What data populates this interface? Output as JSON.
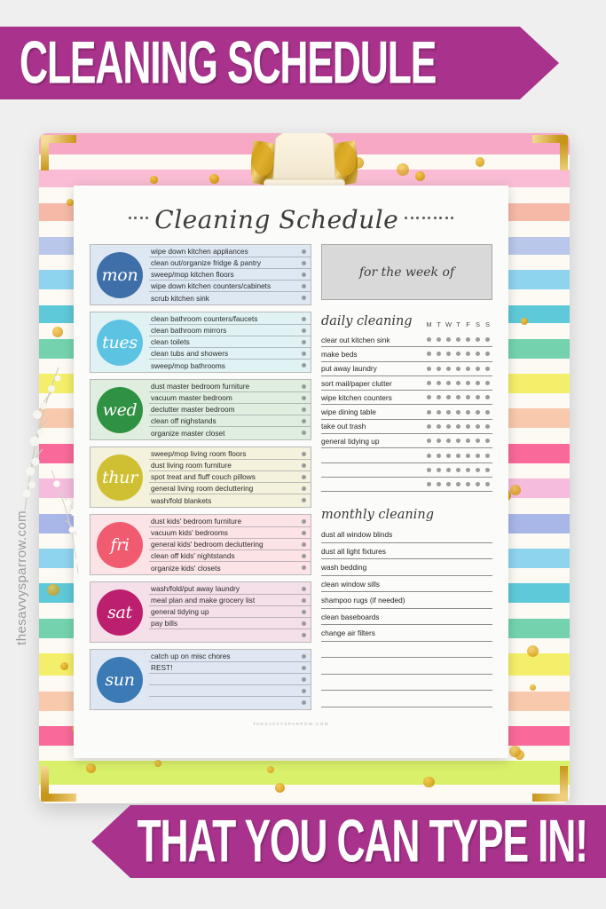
{
  "banners": {
    "top_text": "CLEANING SCHEDULE",
    "bottom_text": "THAT YOU CAN TYPE IN!",
    "color": "#a8328c"
  },
  "side_url": "thesavvysparrow.com",
  "sheet": {
    "title": "Cleaning Schedule",
    "footer": "THESAVVYSPARROW.COM",
    "week_of_label": "for the week of"
  },
  "days": [
    {
      "key": "mon",
      "label": "mon",
      "circle_color": "#3f6fa8",
      "row_color": "#dde8f3",
      "tasks": [
        "wipe down kitchen appliances",
        "clean out/organize fridge & pantry",
        "sweep/mop kitchen floors",
        "wipe down kitchen counters/cabinets",
        "scrub kitchen sink"
      ]
    },
    {
      "key": "tues",
      "label": "tues",
      "circle_color": "#5dc3e3",
      "row_color": "#e0f2f4",
      "tasks": [
        "clean bathroom counters/faucets",
        "clean bathroom mirrors",
        "clean toilets",
        "clean tubs and showers",
        "sweep/mop bathrooms"
      ]
    },
    {
      "key": "wed",
      "label": "wed",
      "circle_color": "#2f9142",
      "row_color": "#dfeede",
      "tasks": [
        "dust master bedroom furniture",
        "vacuum master bedroom",
        "declutter master bedroom",
        "clean off nighstands",
        "organize master closet"
      ]
    },
    {
      "key": "thur",
      "label": "thur",
      "circle_color": "#cfc033",
      "row_color": "#f4f1dc",
      "tasks": [
        "sweep/mop living room floors",
        "dust living room furniture",
        "spot treat and fluff couch pillows",
        "general living room decluttering",
        "wash/fold blankets"
      ]
    },
    {
      "key": "fri",
      "label": "fri",
      "circle_color": "#f15b70",
      "row_color": "#fbe3e6",
      "tasks": [
        "dust kids' bedroom furniture",
        "vacuum kids' bedrooms",
        "general kids' bedroom decluttering",
        "clean off kids' nightstands",
        "organize kids' closets"
      ]
    },
    {
      "key": "sat",
      "label": "sat",
      "circle_color": "#bb1f6e",
      "row_color": "#f5dfe9",
      "tasks": [
        "wash/fold/put away laundry",
        "meal plan and make grocery list",
        "general tidying up",
        "pay bills",
        ""
      ]
    },
    {
      "key": "sun",
      "label": "sun",
      "circle_color": "#3b7ab5",
      "row_color": "#dfe8f2",
      "tasks": [
        "catch up on misc chores",
        "REST!",
        "",
        "",
        ""
      ]
    }
  ],
  "daily": {
    "title": "daily cleaning",
    "dow": [
      "M",
      "T",
      "W",
      "T",
      "F",
      "S",
      "S"
    ],
    "items": [
      "clear out kitchen sink",
      "make beds",
      "put away laundry",
      "sort mail/paper clutter",
      "wipe kitchen counters",
      "wipe dining table",
      "take out trash",
      "general tidying up",
      "",
      "",
      ""
    ]
  },
  "monthly": {
    "title": "monthly cleaning",
    "items": [
      "dust all window blinds",
      "dust all light fixtures",
      "wash bedding",
      "clean window sills",
      "shampoo rugs (if needed)",
      "clean baseboards",
      "change air filters",
      "",
      "",
      "",
      ""
    ]
  },
  "clipboard": {
    "stripes": [
      {
        "color": "#f7a8c4",
        "h": 3.0
      },
      {
        "color": "#fdfaf4",
        "h": 2.2
      },
      {
        "color": "#f9bcd4",
        "h": 2.6
      },
      {
        "color": "#fdfaf4",
        "h": 2.2
      },
      {
        "color": "#f6b9a8",
        "h": 2.6
      },
      {
        "color": "#fdfaf4",
        "h": 2.2
      },
      {
        "color": "#b9c8ea",
        "h": 2.6
      },
      {
        "color": "#fdfaf4",
        "h": 2.2
      },
      {
        "color": "#8fd4ef",
        "h": 2.8
      },
      {
        "color": "#fdfaf4",
        "h": 2.2
      },
      {
        "color": "#5ec9d8",
        "h": 2.6
      },
      {
        "color": "#fdfaf4",
        "h": 2.2
      },
      {
        "color": "#74d3ae",
        "h": 2.8
      },
      {
        "color": "#fdfaf4",
        "h": 2.2
      },
      {
        "color": "#f4ef6a",
        "h": 2.8
      },
      {
        "color": "#fdfaf4",
        "h": 2.2
      },
      {
        "color": "#f8c9ad",
        "h": 2.8
      },
      {
        "color": "#fdfaf4",
        "h": 2.2
      },
      {
        "color": "#f9699a",
        "h": 2.8
      },
      {
        "color": "#fdfaf4",
        "h": 2.2
      },
      {
        "color": "#f5bcdd",
        "h": 2.8
      },
      {
        "color": "#fdfaf4",
        "h": 2.2
      },
      {
        "color": "#a9b6e8",
        "h": 2.8
      },
      {
        "color": "#fdfaf4",
        "h": 2.2
      },
      {
        "color": "#8fd4ef",
        "h": 2.8
      },
      {
        "color": "#fdfaf4",
        "h": 2.2
      },
      {
        "color": "#5ec9d8",
        "h": 2.8
      },
      {
        "color": "#fdfaf4",
        "h": 2.2
      },
      {
        "color": "#74d3ae",
        "h": 2.8
      },
      {
        "color": "#fdfaf4",
        "h": 2.2
      },
      {
        "color": "#f4ef6a",
        "h": 3.2
      },
      {
        "color": "#fdfaf4",
        "h": 2.2
      },
      {
        "color": "#f8c9ad",
        "h": 2.8
      },
      {
        "color": "#fdfaf4",
        "h": 2.2
      },
      {
        "color": "#f9699a",
        "h": 2.8
      },
      {
        "color": "#fdfaf4",
        "h": 2.2
      },
      {
        "color": "#d9f06a",
        "h": 3.4
      },
      {
        "color": "#fdfaf4",
        "h": 2.6
      }
    ]
  }
}
